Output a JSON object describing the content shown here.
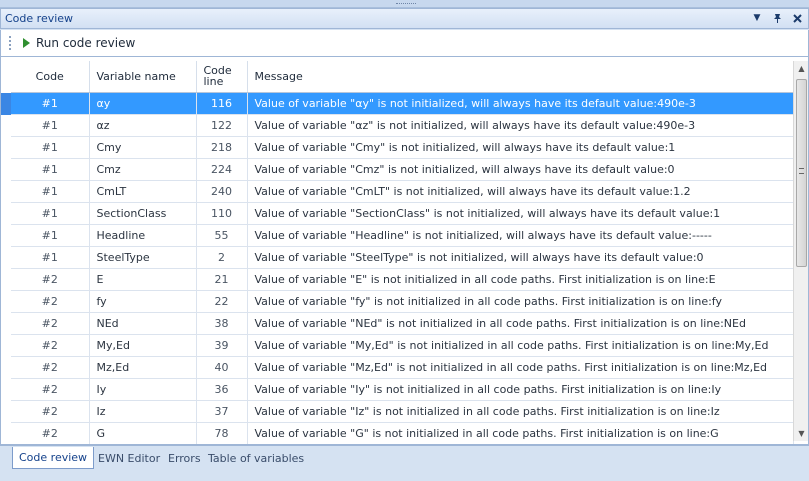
{
  "panel": {
    "title": "Code review"
  },
  "toolbar": {
    "run_label": "Run code review"
  },
  "grid": {
    "columns": [
      "Code",
      "Variable name",
      "Code\nline",
      "Message"
    ],
    "rows": [
      {
        "code": "#1",
        "variable": "αy",
        "line": "116",
        "message": "Value of variable \"αy\" is not initialized, will always have its default value:490e-3"
      },
      {
        "code": "#1",
        "variable": "αz",
        "line": "122",
        "message": "Value of variable \"αz\" is not initialized, will always have its default value:490e-3"
      },
      {
        "code": "#1",
        "variable": "Cmy",
        "line": "218",
        "message": "Value of variable \"Cmy\" is not initialized, will always have its default value:1"
      },
      {
        "code": "#1",
        "variable": "Cmz",
        "line": "224",
        "message": "Value of variable \"Cmz\" is not initialized, will always have its default value:0"
      },
      {
        "code": "#1",
        "variable": "CmLT",
        "line": "240",
        "message": "Value of variable \"CmLT\" is not initialized, will always have its default value:1.2"
      },
      {
        "code": "#1",
        "variable": "SectionClass",
        "line": "110",
        "message": "Value of variable \"SectionClass\" is not initialized, will always have its default value:1"
      },
      {
        "code": "#1",
        "variable": "Headline",
        "line": "55",
        "message": "Value of variable \"Headline\" is not initialized, will always have its default value:-----"
      },
      {
        "code": "#1",
        "variable": "SteelType",
        "line": "2",
        "message": "Value of variable \"SteelType\" is not initialized, will always have its default value:0"
      },
      {
        "code": "#2",
        "variable": "E",
        "line": "21",
        "message": "Value of variable \"E\" is not initialized in all code paths. First initialization is on line:E"
      },
      {
        "code": "#2",
        "variable": "fy",
        "line": "22",
        "message": "Value of variable \"fy\" is not initialized in all code paths. First initialization is on line:fy"
      },
      {
        "code": "#2",
        "variable": "NEd",
        "line": "38",
        "message": "Value of variable \"NEd\" is not initialized in all code paths. First initialization is on line:NEd"
      },
      {
        "code": "#2",
        "variable": "My,Ed",
        "line": "39",
        "message": "Value of variable \"My,Ed\" is not initialized in all code paths. First initialization is on line:My,Ed"
      },
      {
        "code": "#2",
        "variable": "Mz,Ed",
        "line": "40",
        "message": "Value of variable \"Mz,Ed\" is not initialized in all code paths. First initialization is on line:Mz,Ed"
      },
      {
        "code": "#2",
        "variable": "Iy",
        "line": "36",
        "message": "Value of variable \"Iy\" is not initialized in all code paths. First initialization is on line:Iy"
      },
      {
        "code": "#2",
        "variable": "Iz",
        "line": "37",
        "message": "Value of variable \"Iz\" is not initialized in all code paths. First initialization is on line:Iz"
      },
      {
        "code": "#2",
        "variable": "G",
        "line": "78",
        "message": "Value of variable \"G\" is not initialized in all code paths. First initialization is on line:G"
      }
    ]
  },
  "tabs": [
    "Code review",
    "EWN Editor",
    "Errors",
    "Table of variables"
  ],
  "colors": {
    "selection": "#3399ff",
    "accent": "#15428b"
  }
}
